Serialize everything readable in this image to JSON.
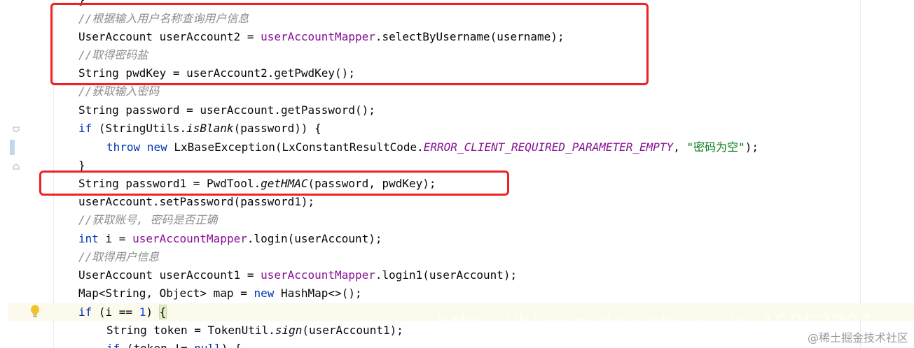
{
  "editor": {
    "lines": [
      {
        "id": "l0",
        "tokens": [
          {
            "t": "}",
            "c": ""
          }
        ]
      },
      {
        "id": "l1",
        "tokens": [
          {
            "t": "//根据输入用户名称查询用户信息",
            "c": "comment"
          }
        ]
      },
      {
        "id": "l2",
        "tokens": [
          {
            "t": "UserAccount userAccount2 = ",
            "c": ""
          },
          {
            "t": "userAccountMapper",
            "c": "field"
          },
          {
            "t": ".selectByUsername(username);",
            "c": ""
          }
        ]
      },
      {
        "id": "l3",
        "tokens": [
          {
            "t": "//取得密码盐",
            "c": "comment"
          }
        ]
      },
      {
        "id": "l4",
        "tokens": [
          {
            "t": "String pwdKey = userAccount2.getPwdKey();",
            "c": ""
          }
        ]
      },
      {
        "id": "l5",
        "tokens": [
          {
            "t": "//获取输入密码",
            "c": "comment"
          }
        ]
      },
      {
        "id": "l6",
        "tokens": [
          {
            "t": "String password = userAccount.getPassword();",
            "c": ""
          }
        ]
      },
      {
        "id": "l7",
        "tokens": [
          {
            "t": "if",
            "c": "kw"
          },
          {
            "t": " (StringUtils.",
            "c": ""
          },
          {
            "t": "isBlank",
            "c": "italic"
          },
          {
            "t": "(password)) {",
            "c": ""
          }
        ]
      },
      {
        "id": "l8",
        "tokens": [
          {
            "t": "throw",
            "c": "kw"
          },
          {
            "t": " ",
            "c": ""
          },
          {
            "t": "new",
            "c": "kw"
          },
          {
            "t": " LxBaseException(LxConstantResultCode.",
            "c": ""
          },
          {
            "t": "ERROR_CLIENT_REQUIRED_PARAMETER_EMPTY",
            "c": "const"
          },
          {
            "t": ", ",
            "c": ""
          },
          {
            "t": "\"密码为空\"",
            "c": "str"
          },
          {
            "t": ");",
            "c": ""
          }
        ]
      },
      {
        "id": "l9",
        "tokens": [
          {
            "t": "}",
            "c": ""
          }
        ]
      },
      {
        "id": "l10",
        "tokens": [
          {
            "t": "String password1 = PwdTool.",
            "c": ""
          },
          {
            "t": "getHMAC",
            "c": "italic"
          },
          {
            "t": "(password, pwdKey);",
            "c": ""
          }
        ]
      },
      {
        "id": "l11",
        "tokens": [
          {
            "t": "userAccount.setPassword(password1);",
            "c": ""
          }
        ]
      },
      {
        "id": "l12",
        "tokens": [
          {
            "t": "//获取账号, 密码是否正确",
            "c": "comment"
          }
        ]
      },
      {
        "id": "l13",
        "tokens": [
          {
            "t": "int",
            "c": "kw"
          },
          {
            "t": " i = ",
            "c": ""
          },
          {
            "t": "userAccountMapper",
            "c": "field"
          },
          {
            "t": ".login(userAccount);",
            "c": ""
          }
        ]
      },
      {
        "id": "l14",
        "tokens": [
          {
            "t": "//取得用户信息",
            "c": "comment"
          }
        ]
      },
      {
        "id": "l15",
        "tokens": [
          {
            "t": "UserAccount userAccount1 = ",
            "c": ""
          },
          {
            "t": "userAccountMapper",
            "c": "field"
          },
          {
            "t": ".login1(userAccount);",
            "c": ""
          }
        ]
      },
      {
        "id": "l16",
        "tokens": [
          {
            "t": "Map<String, Object> map = ",
            "c": ""
          },
          {
            "t": "new",
            "c": "kw"
          },
          {
            "t": " HashMap<>();",
            "c": ""
          }
        ]
      },
      {
        "id": "l17",
        "tokens": [
          {
            "t": "if",
            "c": "kw"
          },
          {
            "t": " (i == ",
            "c": ""
          },
          {
            "t": "1",
            "c": "num"
          },
          {
            "t": ") ",
            "c": ""
          },
          {
            "t": "{",
            "c": "brace"
          }
        ]
      },
      {
        "id": "l18",
        "tokens": [
          {
            "t": "String token = TokenUtil.",
            "c": ""
          },
          {
            "t": "sign",
            "c": "italic"
          },
          {
            "t": "(userAccount1);",
            "c": ""
          }
        ]
      },
      {
        "id": "l19",
        "tokens": [
          {
            "t": "if",
            "c": "kw"
          },
          {
            "t": " (token != ",
            "c": ""
          },
          {
            "t": "null",
            "c": "kw"
          },
          {
            "t": ") {",
            "c": ""
          }
        ]
      }
    ]
  },
  "watermark": {
    "text": "@稀土掘金技术社区",
    "url_ghost": "https://blog.csdn.net/weixin_45853881"
  },
  "icons": {
    "fold": "fold-arrow-icon",
    "bulb": "lightbulb-icon"
  },
  "colors": {
    "keyword": "#0033b3",
    "field": "#871094",
    "comment": "#8c8c8c",
    "string": "#067d17",
    "number": "#1750eb",
    "annotation_box": "#ee2222",
    "current_line": "#fcfaed"
  }
}
